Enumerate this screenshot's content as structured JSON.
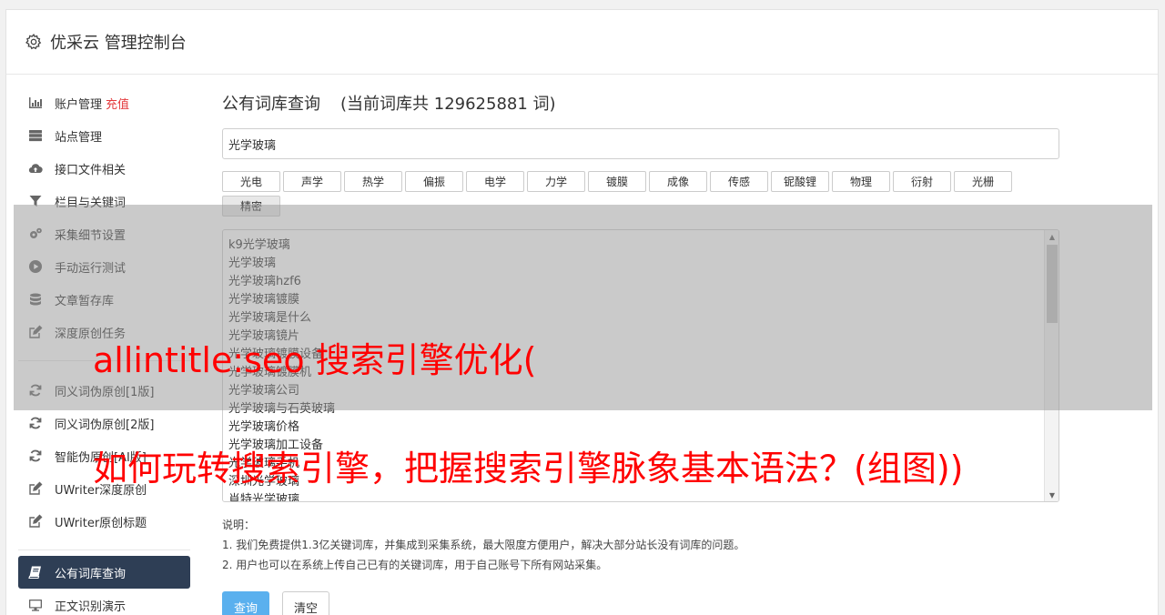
{
  "header": {
    "title": "优采云 管理控制台"
  },
  "sidebar": {
    "items": [
      {
        "label": "账户管理",
        "badge": "充值",
        "icon": "bar-chart-icon"
      },
      {
        "label": "站点管理",
        "icon": "server-icon"
      },
      {
        "label": "接口文件相关",
        "icon": "cloud-upload-icon"
      },
      {
        "label": "栏目与关键词",
        "icon": "filter-icon"
      },
      {
        "label": "采集细节设置",
        "icon": "gears-icon"
      },
      {
        "label": "手动运行测试",
        "icon": "play-circle-icon"
      },
      {
        "label": "文章暂存库",
        "icon": "database-icon"
      },
      {
        "label": "深度原创任务",
        "icon": "edit-icon"
      },
      {
        "label": "同义词伪原创[1版]",
        "icon": "refresh-icon"
      },
      {
        "label": "同义词伪原创[2版]",
        "icon": "refresh-icon"
      },
      {
        "label": "智能伪原创[AI版]",
        "icon": "refresh-icon"
      },
      {
        "label": "UWriter深度原创",
        "icon": "edit-icon"
      },
      {
        "label": "UWriter原创标题",
        "icon": "edit-icon"
      },
      {
        "label": "公有词库查询",
        "icon": "book-icon"
      },
      {
        "label": "正文识别演示",
        "icon": "monitor-icon"
      }
    ]
  },
  "main": {
    "title": "公有词库查询",
    "count_text": "(当前词库共 129625881 词)",
    "search_value": "光学玻璃",
    "tags": [
      "光电",
      "声学",
      "热学",
      "偏振",
      "电学",
      "力学",
      "镀膜",
      "成像",
      "传感",
      "铌酸锂",
      "物理",
      "衍射",
      "光栅",
      "精密"
    ],
    "results": [
      "k9光学玻璃",
      "光学玻璃",
      "光学玻璃hzf6",
      "光学玻璃镀膜",
      "光学玻璃是什么",
      "光学玻璃镜片",
      "光学玻璃镀膜设备",
      "光学玻璃镀膜机",
      "光学玻璃公司",
      "光学玻璃与石英玻璃",
      "光学玻璃价格",
      "光学玻璃加工设备",
      "光学玻璃手机",
      "深圳光学玻璃",
      "肖特光学玻璃"
    ],
    "notes": {
      "heading": "说明：",
      "line1": "1. 我们免费提供1.3亿关键词库，并集成到采集系统，最大限度方便用户，解决大部分站长没有词库的问题。",
      "line2": "2. 用户也可以在系统上传自己已有的关键词库，用于自己账号下所有网站采集。"
    },
    "buttons": {
      "query": "查询",
      "clear": "清空"
    }
  },
  "watermark": {
    "line1": "allintitle:seo 搜索引擎优化(",
    "line2": "如何玩转搜索引擎，把握搜索引擎脉象基本语法？(组图))"
  },
  "colors": {
    "active_bg": "#2e3e55",
    "primary": "#5ab0ee",
    "badge": "#e4393c",
    "watermark": "#ff0000"
  }
}
